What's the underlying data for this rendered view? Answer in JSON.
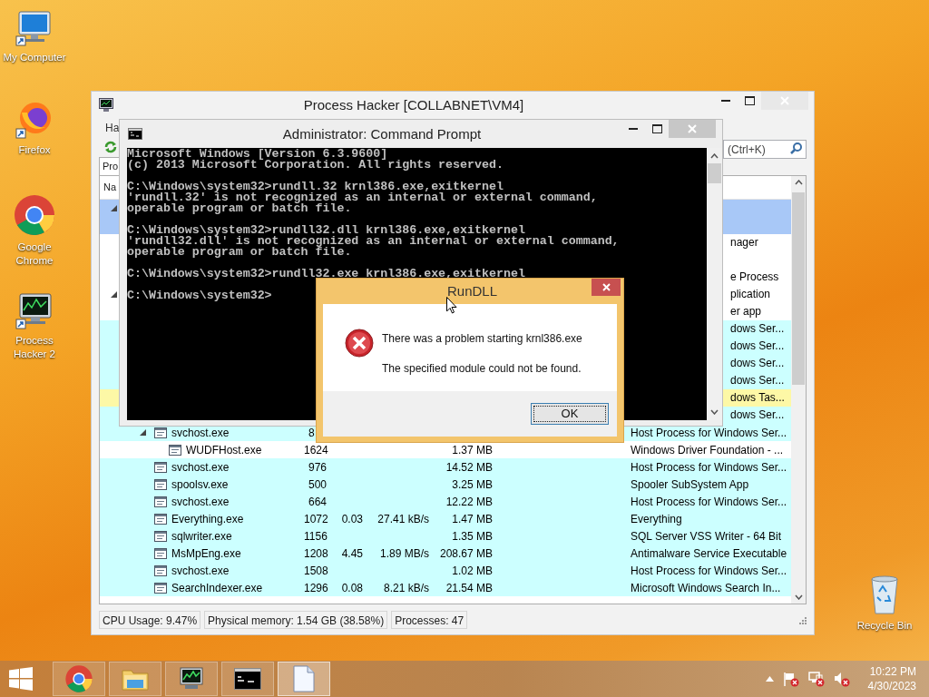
{
  "desktop_icons": [
    {
      "kind": "computer",
      "label": "My Computer"
    },
    {
      "kind": "firefox",
      "label": "Firefox"
    },
    {
      "kind": "chrome",
      "label": "Google Chrome"
    },
    {
      "kind": "hacker",
      "label": "Process Hacker 2"
    },
    {
      "kind": "bin",
      "label": "Recycle Bin"
    }
  ],
  "process_hacker": {
    "title": "Process Hacker [COLLABNET\\VM4]",
    "menu": [
      {
        "label": "Ha"
      }
    ],
    "tabs": [
      {
        "label": "Pro",
        "selected": true
      }
    ],
    "search": {
      "placeholder": "(Ctrl+K)"
    },
    "columns": [
      {
        "label": "Na"
      }
    ],
    "rows": [
      {
        "kind": "covered",
        "selected": true,
        "expanded": true,
        "children": [
          {
            "kind": "covered",
            "selected": true
          },
          {
            "kind": "covered",
            "selected": false,
            "color": "#ffffff",
            "description": "nager"
          },
          {
            "kind": "covered",
            "selected": false,
            "color": "#ffffff"
          },
          {
            "kind": "covered",
            "selected": false,
            "color": "#ffffff",
            "description": "e Process"
          }
        ]
      },
      {
        "kind": "covered",
        "selected": false,
        "color": "#ffffff",
        "description": "plication",
        "expanded": true,
        "children": [
          {
            "kind": "covered",
            "selected": false,
            "color": "#ffffff",
            "description": "er app",
            "children": [
              {
                "kind": "covered",
                "selected": false,
                "color": "#ccffff",
                "description": "dows Ser..."
              },
              {
                "kind": "covered",
                "selected": false,
                "color": "#ccffff",
                "description": "dows Ser..."
              },
              {
                "kind": "covered",
                "selected": false,
                "color": "#ccffff",
                "description": "dows Ser..."
              },
              {
                "kind": "covered",
                "selected": false,
                "color": "#ccffff",
                "description": "dows Ser..."
              },
              {
                "kind": "covered",
                "selected": false,
                "color": "#fdf8a6",
                "description": "dows Tas..."
              },
              {
                "kind": "covered",
                "selected": false,
                "color": "#ccffff",
                "description": "dows Ser..."
              },
              {
                "kind": "process",
                "selected": false,
                "color": "#ccffff",
                "name": "svchost.exe",
                "pid": "8",
                "pid_cut": true,
                "description": "Host Process for Windows Ser...",
                "expanded": true,
                "children": [
                  {
                    "kind": "process",
                    "selected": false,
                    "color": "#ffffff",
                    "name": "WUDFHost.exe",
                    "pid": "1624",
                    "memory": "1.37 MB",
                    "description": "Windows Driver Foundation - ..."
                  }
                ]
              },
              {
                "kind": "process",
                "selected": false,
                "color": "#ccffff",
                "name": "svchost.exe",
                "pid": "976",
                "memory": "14.52 MB",
                "description": "Host Process for Windows Ser..."
              },
              {
                "kind": "process",
                "selected": false,
                "color": "#ccffff",
                "name": "spoolsv.exe",
                "pid": "500",
                "memory": "3.25 MB",
                "description": "Spooler SubSystem App"
              },
              {
                "kind": "process",
                "selected": false,
                "color": "#ccffff",
                "name": "svchost.exe",
                "pid": "664",
                "memory": "12.22 MB",
                "description": "Host Process for Windows Ser..."
              },
              {
                "kind": "process",
                "selected": false,
                "color": "#ccffff",
                "name": "Everything.exe",
                "pid": "1072",
                "cpu": "0.03",
                "io": "27.41 kB/s",
                "memory": "1.47 MB",
                "description": "Everything"
              },
              {
                "kind": "process",
                "selected": false,
                "color": "#ccffff",
                "name": "sqlwriter.exe",
                "pid": "1156",
                "memory": "1.35 MB",
                "description": "SQL Server VSS Writer - 64 Bit"
              },
              {
                "kind": "process",
                "selected": false,
                "color": "#ccffff",
                "name": "MsMpEng.exe",
                "pid": "1208",
                "cpu": "4.45",
                "io": "1.89 MB/s",
                "memory": "208.67 MB",
                "description": "Antimalware Service Executable"
              },
              {
                "kind": "process",
                "selected": false,
                "color": "#ccffff",
                "name": "svchost.exe",
                "pid": "1508",
                "memory": "1.02 MB",
                "description": "Host Process for Windows Ser..."
              },
              {
                "kind": "process",
                "selected": false,
                "color": "#ccffff",
                "name": "SearchIndexer.exe",
                "pid": "1296",
                "cpu": "0.08",
                "io": "8.21 kB/s",
                "memory": "21.54 MB",
                "description": "Microsoft Windows Search In..."
              }
            ]
          }
        ]
      }
    ],
    "status_bar": [
      "CPU Usage: 9.47%",
      "Physical memory: 1.54 GB (38.58%)",
      "Processes: 47"
    ]
  },
  "command_prompt": {
    "title": "Administrator:  Command Prompt",
    "blocks": [
      [
        "Microsoft Windows [Version 6.3.9600]",
        "(c) 2013 Microsoft Corporation. All rights reserved."
      ],
      [
        "C:\\Windows\\system32>rundll.32 krnl386.exe,exitkernel",
        "'rundll.32' is not recognized as an internal or external command,",
        "operable program or batch file."
      ],
      [
        "C:\\Windows\\system32>rundll32.dll krnl386.exe,exitkernel",
        "'rundll32.dll' is not recognized as an internal or external command,",
        "operable program or batch file."
      ],
      [
        "C:\\Windows\\system32>rundll32.exe krnl386.exe,exitkernel"
      ],
      [
        "C:\\Windows\\system32>"
      ]
    ]
  },
  "dialog": {
    "title": "RunDLL",
    "message": "There was a problem starting krnl386.exe",
    "detail": "The specified module could not be found.",
    "button": "OK"
  },
  "taskbar": {
    "buttons": [
      {
        "kind": "chrome",
        "selected": false
      },
      {
        "kind": "explorer",
        "selected": false
      },
      {
        "kind": "hacker",
        "selected": false
      },
      {
        "kind": "console",
        "selected": false
      },
      {
        "kind": "document",
        "selected": true
      }
    ],
    "clock": {
      "time": "10:22 PM",
      "date": "4/30/2023"
    }
  }
}
